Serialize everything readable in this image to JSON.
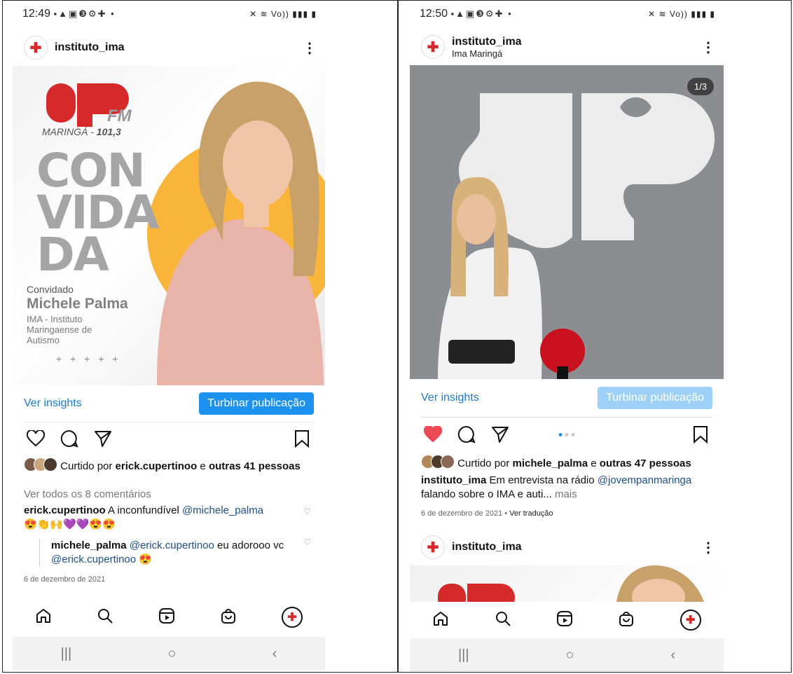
{
  "left": {
    "status": {
      "time": "12:49",
      "icons": "▪▲▣❸⚙✚ •",
      "right": "✕ ≋ Vo)) ▮▮▮ ▮"
    },
    "post": {
      "username": "instituto_ima",
      "more_icon": "⋮",
      "image_text": {
        "brand": "JP",
        "fm": "FM",
        "city": "MARINGÁ - ",
        "freq": "101,3",
        "title": [
          "CON",
          "VIDA",
          "DA"
        ],
        "label": "Convidado",
        "name": "Michele Palma",
        "org": "IMA - Instituto Maringaense de Autismo",
        "plus": "+ + + + +"
      },
      "insights": "Ver insights",
      "promote": "Turbinar publicação",
      "liked_prefix": "Curtido por ",
      "liked_user": "erick.cupertinoo",
      "liked_and": " e ",
      "liked_others": "outras 41 pessoas",
      "view_comments": "Ver todos os 8 comentários",
      "comments": [
        {
          "user": "erick.cupertinoo",
          "text": " A inconfundível ",
          "mention": "@michele_palma",
          "emoji": "😍👏🙌💜💜😍😍"
        },
        {
          "user": "michele_palma",
          "mention": "@erick.cupertinoo",
          "text": " eu adorooo vc ",
          "mention2": "@erick.cupertinoo",
          "emoji": "😍"
        }
      ],
      "date": "6 de dezembro de 2021"
    }
  },
  "right": {
    "status": {
      "time": "12:50",
      "icons": "▪▲▣❸⚙✚ •",
      "right": "✕ ≋ Vo)) ▮▮▮ ▮"
    },
    "post": {
      "username": "instituto_ima",
      "location": "Ima Maringá",
      "more_icon": "⋮",
      "counter": "1/3",
      "insights": "Ver insights",
      "promote": "Turbinar publicação",
      "liked_prefix": "Curtido por ",
      "liked_user": "michele_palma",
      "liked_and": " e ",
      "liked_others": "outras 47 pessoas",
      "caption_user": "instituto_ima",
      "caption_text": " Em entrevista na rádio ",
      "caption_mention": "@jovempanmaringa",
      "caption_rest": " falando sobre o IMA e auti... ",
      "more": "mais",
      "date": "6 de dezembro de 2021",
      "sep": " • ",
      "translate": "Ver tradução"
    },
    "next_post": {
      "username": "instituto_ima",
      "more_icon": "⋮"
    }
  },
  "nav": {
    "recent": "|||",
    "home": "○",
    "back": "‹"
  },
  "colors": {
    "accent": "#1c92ee",
    "heart": "#ed4956",
    "link": "#1f79c8",
    "brand_red": "#d62a2a",
    "sun": "#f9b53a"
  }
}
